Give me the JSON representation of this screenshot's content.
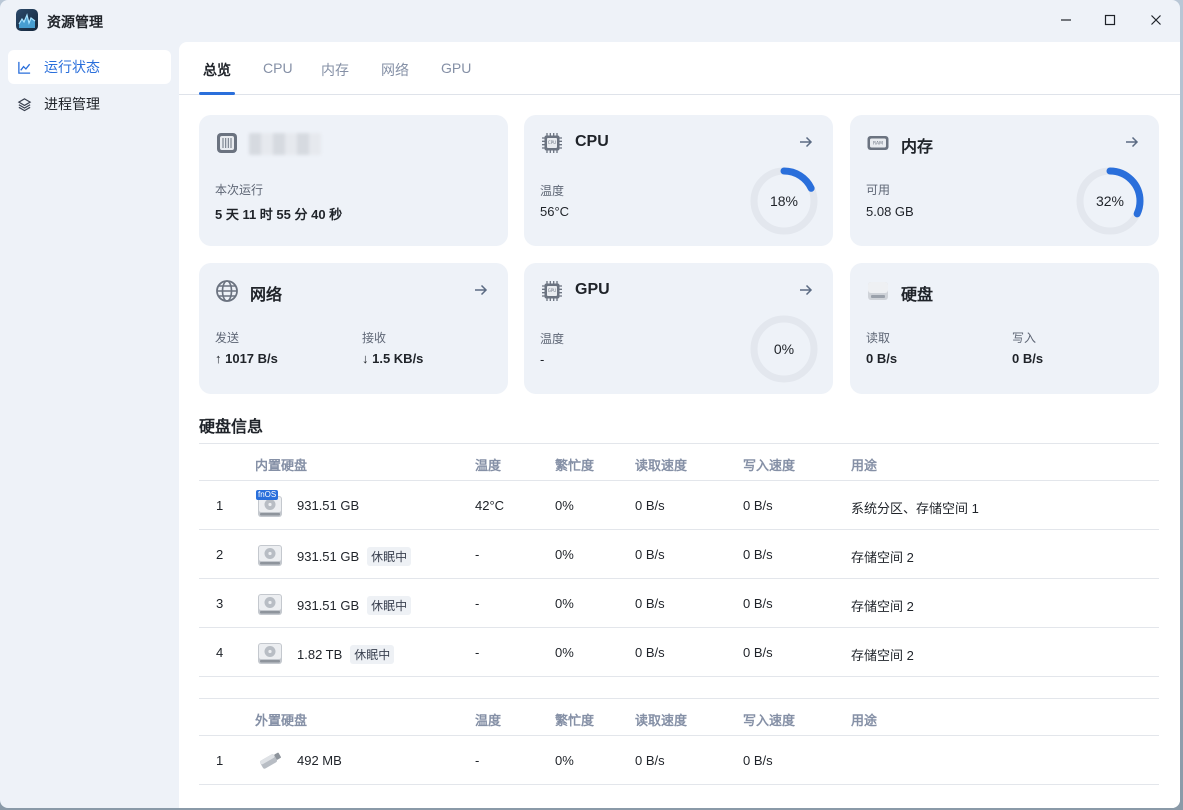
{
  "app": {
    "title": "资源管理"
  },
  "window_controls": {
    "minimize": "—",
    "maximize": "☐",
    "close": "✕"
  },
  "sidebar": {
    "items": [
      {
        "label": "运行状态",
        "icon": "line-chart-icon",
        "active": true
      },
      {
        "label": "进程管理",
        "icon": "layers-icon",
        "active": false
      }
    ]
  },
  "tabs": [
    {
      "label": "总览",
      "active": true
    },
    {
      "label": "CPU",
      "active": false
    },
    {
      "label": "内存",
      "active": false
    },
    {
      "label": "网络",
      "active": false
    },
    {
      "label": "GPU",
      "active": false
    }
  ],
  "cards": {
    "system": {
      "uptime_label": "本次运行",
      "uptime_value": "5 天 11 时 55 分 40 秒"
    },
    "cpu": {
      "title": "CPU",
      "temp_label": "温度",
      "temp_value": "56°C",
      "usage_text": "18%",
      "usage_fraction": 0.18
    },
    "memory": {
      "title": "内存",
      "avail_label": "可用",
      "avail_value": "5.08 GB",
      "usage_text": "32%",
      "usage_fraction": 0.32
    },
    "network": {
      "title": "网络",
      "send_label": "发送",
      "send_value": "↑ 1017 B/s",
      "recv_label": "接收",
      "recv_value": "↓ 1.5 KB/s"
    },
    "gpu": {
      "title": "GPU",
      "temp_label": "温度",
      "temp_value": "-",
      "usage_text": "0%",
      "usage_fraction": 0
    },
    "disk": {
      "title": "硬盘",
      "read_label": "读取",
      "read_value": "0 B/s",
      "write_label": "写入",
      "write_value": "0 B/s"
    }
  },
  "disk_info": {
    "title": "硬盘信息",
    "internal": {
      "headers": [
        "内置硬盘",
        "温度",
        "繁忙度",
        "读取速度",
        "写入速度",
        "用途"
      ],
      "rows": [
        {
          "index": "1",
          "size": "931.51 GB",
          "badge": "",
          "temp": "42°C",
          "busy": "0%",
          "read": "0 B/s",
          "write": "0 B/s",
          "usage": "系统分区、存储空间 1",
          "system_disk": true
        },
        {
          "index": "2",
          "size": "931.51 GB",
          "badge": "休眠中",
          "temp": "-",
          "busy": "0%",
          "read": "0 B/s",
          "write": "0 B/s",
          "usage": "存储空间 2",
          "system_disk": false
        },
        {
          "index": "3",
          "size": "931.51 GB",
          "badge": "休眠中",
          "temp": "-",
          "busy": "0%",
          "read": "0 B/s",
          "write": "0 B/s",
          "usage": "存储空间 2",
          "system_disk": false
        },
        {
          "index": "4",
          "size": "1.82 TB",
          "badge": "休眠中",
          "temp": "-",
          "busy": "0%",
          "read": "0 B/s",
          "write": "0 B/s",
          "usage": "存储空间 2",
          "system_disk": false
        }
      ],
      "system_disk_tag": "fnOS"
    },
    "external": {
      "headers": [
        "外置硬盘",
        "温度",
        "繁忙度",
        "读取速度",
        "写入速度",
        "用途"
      ],
      "rows": [
        {
          "index": "1",
          "size": "492 MB",
          "temp": "-",
          "busy": "0%",
          "read": "0 B/s",
          "write": "0 B/s",
          "usage": ""
        }
      ]
    }
  },
  "colors": {
    "accent": "#2a6fdb",
    "ring_track": "#e3e7ee",
    "card_bg": "#eef2f8"
  }
}
